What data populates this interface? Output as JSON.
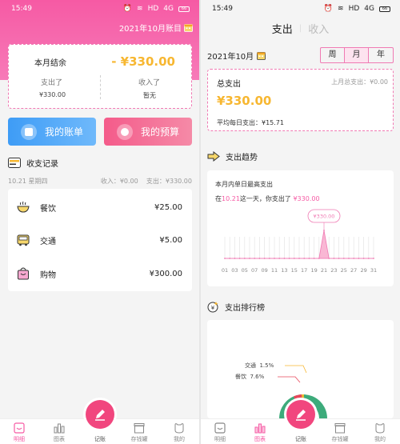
{
  "status": {
    "time": "15:49",
    "network": "HD",
    "signal": "4G",
    "battery": "66"
  },
  "left": {
    "ledger_month": "2021年10月账目",
    "summary": {
      "title": "本月结余",
      "amount": "- ¥330.00",
      "expense_label": "支出了",
      "expense_value": "¥330.00",
      "income_label": "收入了",
      "income_value": "暂无"
    },
    "buttons": {
      "ledger": "我的账单",
      "budget": "我的预算"
    },
    "records": {
      "title": "收支记录",
      "date": "10.21 星期四",
      "income": "收入：¥0.00",
      "expense": "支出：¥330.00",
      "items": [
        {
          "name": "餐饮",
          "amount": "¥25.00",
          "icon": "food-bowl-icon"
        },
        {
          "name": "交通",
          "amount": "¥5.00",
          "icon": "bus-icon"
        },
        {
          "name": "购物",
          "amount": "¥300.00",
          "icon": "shopping-bag-icon"
        }
      ]
    }
  },
  "nav": {
    "items": [
      {
        "label": "明细",
        "icon": "detail-icon"
      },
      {
        "label": "图表",
        "icon": "chart-icon"
      },
      {
        "label": "记账",
        "icon": "pen-icon"
      },
      {
        "label": "存钱罐",
        "icon": "piggy-box-icon"
      },
      {
        "label": "我的",
        "icon": "profile-icon"
      }
    ]
  },
  "right": {
    "tabs": {
      "expense": "支出",
      "income": "收入"
    },
    "month": "2021年10月",
    "period": [
      "周",
      "月",
      "年"
    ],
    "total": {
      "title": "总支出",
      "prev": "上月总支出：¥0.00",
      "amount": "¥330.00",
      "avg": "平均每日支出：¥15.71"
    },
    "trend": {
      "title": "支出趋势",
      "subtitle": "本月内单日最高支出",
      "desc_prefix": "在",
      "desc_date": "10.21",
      "desc_mid": "这一天，你支出了",
      "desc_amount": "¥330.00",
      "bubble": "¥330.00"
    },
    "ranking": {
      "title": "支出排行榜",
      "labels": [
        {
          "name": "交通",
          "pct": "1.5%"
        },
        {
          "name": "餐饮",
          "pct": "7.6%"
        }
      ]
    }
  },
  "chart_data": {
    "type": "line",
    "x": [
      "01",
      "02",
      "03",
      "04",
      "05",
      "06",
      "07",
      "08",
      "09",
      "10",
      "11",
      "12",
      "13",
      "14",
      "15",
      "16",
      "17",
      "18",
      "19",
      "20",
      "21",
      "22",
      "23",
      "24",
      "25",
      "26",
      "27",
      "28",
      "29",
      "30",
      "31"
    ],
    "tick_labels": [
      "01",
      "03",
      "05",
      "07",
      "09",
      "11",
      "13",
      "15",
      "17",
      "19",
      "21",
      "23",
      "25",
      "27",
      "29",
      "31"
    ],
    "values": [
      0,
      0,
      0,
      0,
      0,
      0,
      0,
      0,
      0,
      0,
      0,
      0,
      0,
      0,
      0,
      0,
      0,
      0,
      0,
      0,
      330,
      0,
      0,
      0,
      0,
      0,
      0,
      0,
      0,
      0,
      0
    ],
    "peak": {
      "x": "21",
      "value": 330,
      "label": "¥330.00"
    },
    "colors": {
      "line": "#f07ab3",
      "area": "#f9b7d4"
    }
  },
  "colors": {
    "pink": "#f65aa4",
    "gold": "#f7b731",
    "blue": "#3e9cf6",
    "green": "#3dab7b",
    "red": "#e8475b"
  }
}
